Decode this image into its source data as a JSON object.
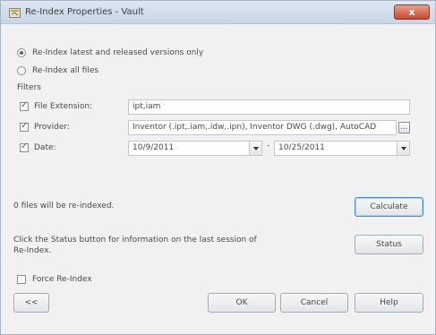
{
  "window": {
    "title": "Re-Index Properties - Vault",
    "close_glyph": "x"
  },
  "options": {
    "reindex_latest_label": "Re-Index latest and released versions only",
    "reindex_all_label": "Re-Index all files",
    "selected": "latest"
  },
  "filters": {
    "header": "Filters",
    "file_extension": {
      "label": "File Extension:",
      "value": "ipt,iam",
      "checked": true
    },
    "provider": {
      "label": "Provider:",
      "value": "Inventor (.ipt,.iam,.idw,.ipn), Inventor DWG (.dwg), AutoCAD",
      "checked": true,
      "browse_glyph": "..."
    },
    "date": {
      "label": "Date:",
      "from": "10/9/2011",
      "separator": "-",
      "to": "10/25/2011",
      "checked": true
    }
  },
  "status": {
    "files_message": "0 files will be re-indexed.",
    "calculate_label": "Calculate",
    "status_hint_line1": "Click the Status button for information on the last session of",
    "status_hint_line2": "Re-Index.",
    "status_label": "Status"
  },
  "force": {
    "label": "Force Re-Index",
    "checked": false
  },
  "footer": {
    "expand_label": "<<",
    "ok_label": "OK",
    "cancel_label": "Cancel",
    "help_label": "Help"
  }
}
